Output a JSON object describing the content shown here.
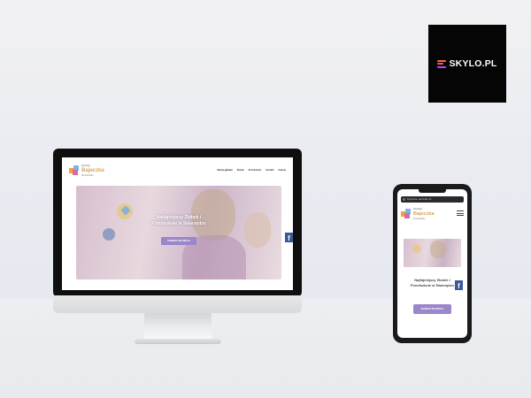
{
  "brand": {
    "logo_text": "SKYLO.PL",
    "background": "#050505"
  },
  "site": {
    "logo_top": "Żłobek",
    "logo_name": "Bajeczka",
    "logo_bottom": "Przedszkole",
    "nav": [
      "Strona główna",
      "Żłobek",
      "Przedszkole",
      "Kontakt",
      "Galeria"
    ],
    "hero_title": "Najfajniejszy Żłobek i Przedszkole w Swarzędzu",
    "hero_button": "DOWIEDZ SIĘ WIĘCEJ",
    "facebook_label": "f",
    "accent": "#9a86c9",
    "facebook_color": "#3b5998"
  },
  "mobile": {
    "url": "bajeczka.swarzedz.pl"
  }
}
